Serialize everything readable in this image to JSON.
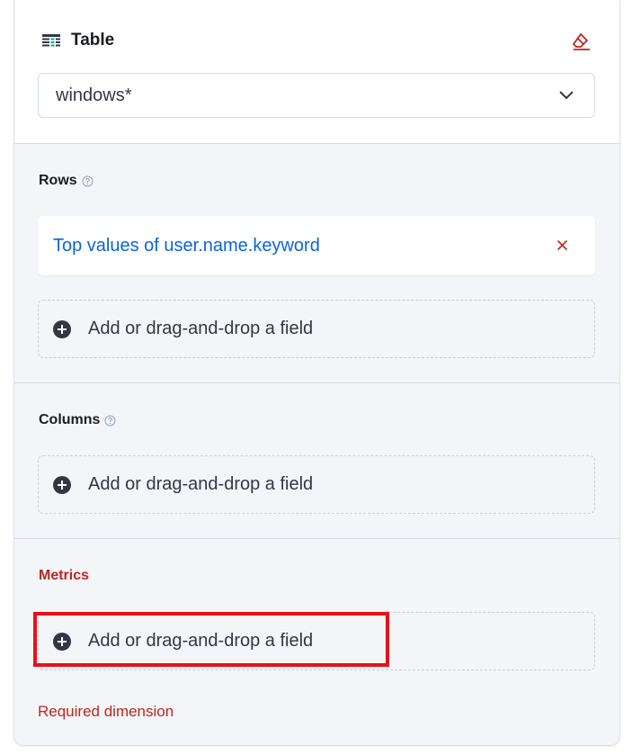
{
  "header": {
    "title": "Table",
    "icon": "table-icon",
    "reset_icon": "eraser-icon",
    "index_pattern": "windows*"
  },
  "rows": {
    "label": "Rows",
    "field": "Top values of user.name.keyword",
    "add_label": "Add or drag-and-drop a field"
  },
  "columns": {
    "label": "Columns",
    "add_label": "Add or drag-and-drop a field"
  },
  "metrics": {
    "label": "Metrics",
    "add_label": "Add or drag-and-drop a field",
    "error": "Required dimension"
  },
  "colors": {
    "panel_bg": "#f3f5f9",
    "link_blue": "#0b64dd",
    "danger_red": "#bd271e",
    "highlight_red": "#e8101b"
  }
}
